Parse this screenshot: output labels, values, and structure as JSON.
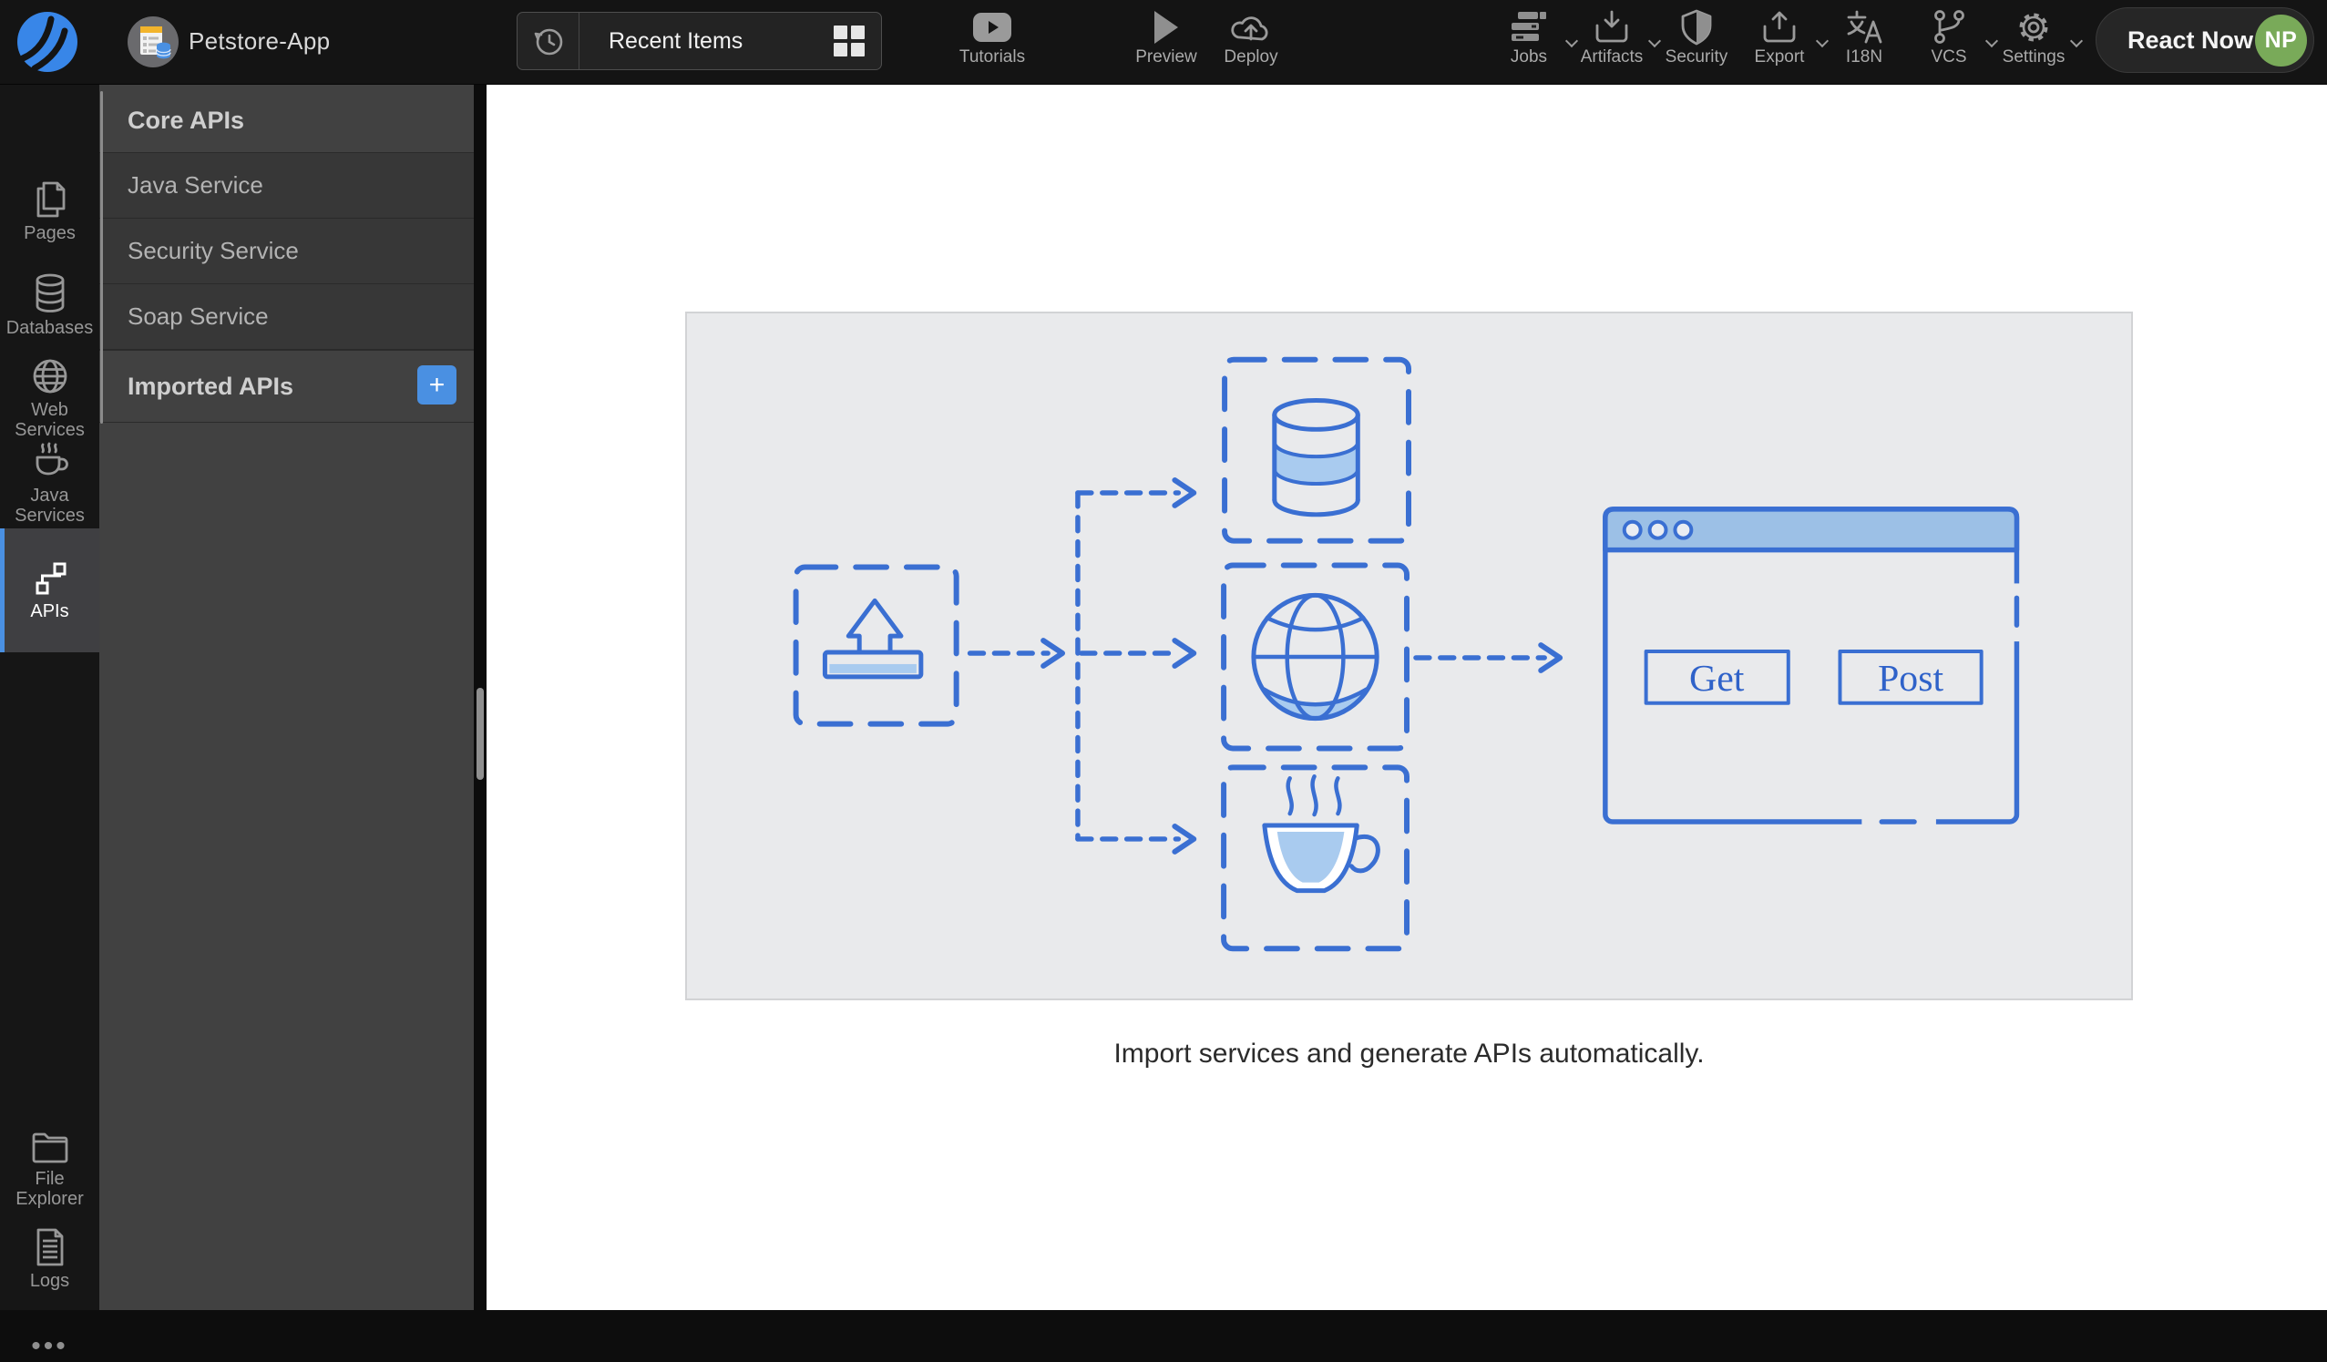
{
  "header": {
    "app_title": "Petstore-App",
    "recent_items": {
      "label": "Recent Items"
    },
    "tools": [
      {
        "label": "Tutorials"
      },
      {
        "label": "Preview"
      },
      {
        "label": "Deploy"
      }
    ],
    "menus": [
      {
        "label": "Jobs"
      },
      {
        "label": "Artifacts"
      },
      {
        "label": "Security"
      },
      {
        "label": "Export"
      },
      {
        "label": "I18N"
      },
      {
        "label": "VCS"
      },
      {
        "label": "Settings"
      }
    ],
    "react_now_label": "React Now",
    "avatar_initials": "NP"
  },
  "sidebar": {
    "items": [
      {
        "label": "Pages",
        "active": false
      },
      {
        "label": "Databases",
        "active": false
      },
      {
        "label": "Web Services",
        "active": false
      },
      {
        "label": "Java Services",
        "active": false
      },
      {
        "label": "APIs",
        "active": true
      }
    ],
    "bottom_items": [
      {
        "label": "File Explorer"
      },
      {
        "label": "Logs"
      }
    ],
    "more_label": "•••"
  },
  "panel": {
    "core_apis_header": "Core APIs",
    "services": [
      {
        "label": "Java Service"
      },
      {
        "label": "Security Service"
      },
      {
        "label": "Soap Service"
      }
    ],
    "imported_apis_header": "Imported APIs",
    "add_button_label": "+"
  },
  "main": {
    "caption": "Import services and generate APIs automatically.",
    "diagram": {
      "get_label": "Get",
      "post_label": "Post"
    }
  },
  "colors": {
    "accent_blue": "#4a90e2",
    "diagram_blue": "#3a6fd2",
    "diagram_light_blue": "#a9cbef",
    "browser_titlebar": "#9cc0e6",
    "avatar_green": "#79aa59"
  }
}
